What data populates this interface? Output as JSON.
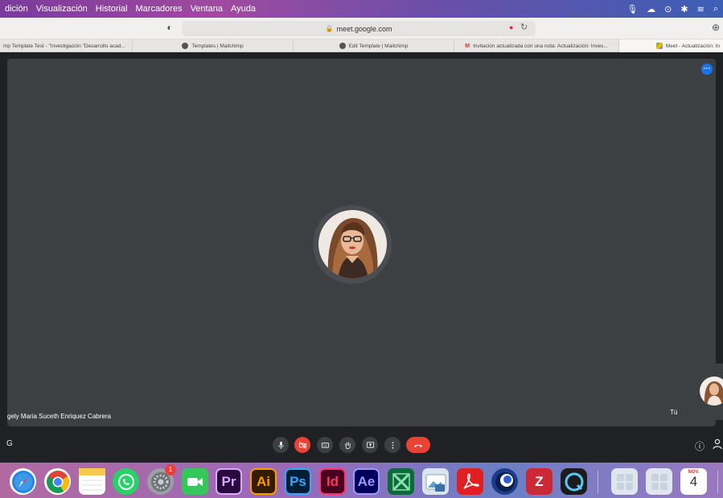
{
  "menubar": {
    "items": [
      "dición",
      "Visualización",
      "Historial",
      "Marcadores",
      "Ventana",
      "Ayuda"
    ]
  },
  "toolbar": {
    "url": "meet.google.com"
  },
  "tabs": [
    "mp Template Test - \"Investigación \"Desarrollo acad...",
    "Templates | Mailchimp",
    "Edit Template | Mailchimp",
    "Invitación actualizada con una nota: Actualización: Inves...",
    "Meet - Actualización: In"
  ],
  "meet": {
    "participant_name": "gely Maria Suceth Enriquez Cabrera",
    "self_label": "Tú",
    "left_label": "G"
  },
  "dock": {
    "settings_badge": "1",
    "pr": "Pr",
    "ai": "Ai",
    "ps": "Ps",
    "id": "Id",
    "ae": "Ae",
    "calendar_month": "NOV.",
    "calendar_day": "4"
  },
  "colors": {
    "stage": "#3c4043",
    "meet_bg": "#202124",
    "red": "#ea4335",
    "blue": "#1a73e8"
  }
}
